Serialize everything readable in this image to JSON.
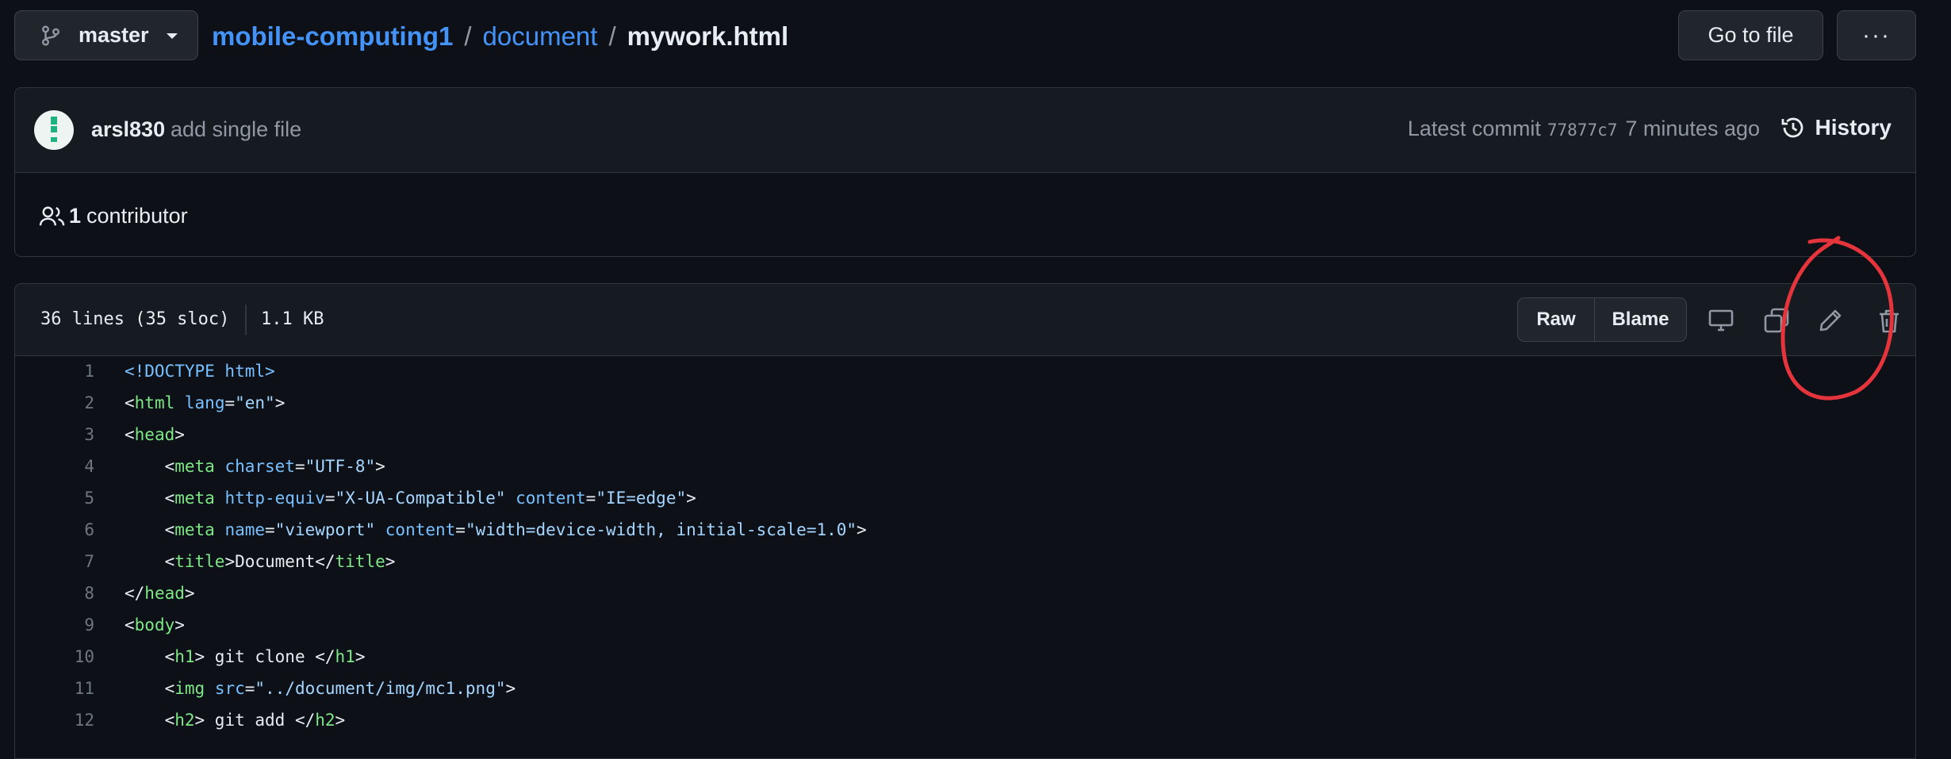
{
  "branch": {
    "name": "master"
  },
  "breadcrumb": {
    "repo": "mobile-computing1",
    "sep1": "/",
    "folder": "document",
    "sep2": "/",
    "file": "mywork.html"
  },
  "actions": {
    "go_to_file": "Go to file",
    "more": "···"
  },
  "commit": {
    "author": "arsl830",
    "message": "add single file",
    "latest_label": "Latest commit",
    "sha": "77877c7",
    "time": "7 minutes ago",
    "history": "History"
  },
  "contributors": {
    "count": "1",
    "label": "contributor"
  },
  "file_info": {
    "lines": "36 lines (35 sloc)",
    "size": "1.1 KB"
  },
  "file_actions": {
    "raw": "Raw",
    "blame": "Blame"
  },
  "code_lines": [
    {
      "n": "1",
      "tokens": [
        {
          "t": "<!DOCTYPE html>",
          "c": "at"
        }
      ]
    },
    {
      "n": "2",
      "tokens": [
        {
          "t": "<",
          "c": "p"
        },
        {
          "t": "html",
          "c": "tg"
        },
        {
          "t": " ",
          "c": "p"
        },
        {
          "t": "lang",
          "c": "at"
        },
        {
          "t": "=\"en\"",
          "c": "p"
        },
        {
          "t": ">",
          "c": "p"
        }
      ]
    },
    {
      "n": "3",
      "tokens": [
        {
          "t": "<",
          "c": "p"
        },
        {
          "t": "head",
          "c": "tg"
        },
        {
          "t": ">",
          "c": "p"
        }
      ]
    },
    {
      "n": "4",
      "tokens": [
        {
          "t": "    <",
          "c": "p"
        },
        {
          "t": "meta",
          "c": "tg"
        },
        {
          "t": " ",
          "c": "p"
        },
        {
          "t": "charset",
          "c": "at"
        },
        {
          "t": "=\"UTF-8\">",
          "c": "p"
        }
      ]
    },
    {
      "n": "5",
      "tokens": [
        {
          "t": "    <",
          "c": "p"
        },
        {
          "t": "meta",
          "c": "tg"
        },
        {
          "t": " ",
          "c": "p"
        },
        {
          "t": "http-equiv",
          "c": "at"
        },
        {
          "t": "=\"X-UA-Compatible\" ",
          "c": "p"
        },
        {
          "t": "content",
          "c": "at"
        },
        {
          "t": "=\"IE=edge\">",
          "c": "p"
        }
      ]
    },
    {
      "n": "6",
      "tokens": [
        {
          "t": "    <",
          "c": "p"
        },
        {
          "t": "meta",
          "c": "tg"
        },
        {
          "t": " ",
          "c": "p"
        },
        {
          "t": "name",
          "c": "at"
        },
        {
          "t": "=\"viewport\" ",
          "c": "p"
        },
        {
          "t": "content",
          "c": "at"
        },
        {
          "t": "=\"width=device-width, initial-scale=1.0\">",
          "c": "p"
        }
      ]
    },
    {
      "n": "7",
      "tokens": [
        {
          "t": "    <",
          "c": "p"
        },
        {
          "t": "title",
          "c": "tg"
        },
        {
          "t": ">Document</",
          "c": "p"
        },
        {
          "t": "title",
          "c": "tg"
        },
        {
          "t": ">",
          "c": "p"
        }
      ]
    },
    {
      "n": "8",
      "tokens": [
        {
          "t": "</",
          "c": "p"
        },
        {
          "t": "head",
          "c": "tg"
        },
        {
          "t": ">",
          "c": "p"
        }
      ]
    },
    {
      "n": "9",
      "tokens": [
        {
          "t": "<",
          "c": "p"
        },
        {
          "t": "body",
          "c": "tg"
        },
        {
          "t": ">",
          "c": "p"
        }
      ]
    },
    {
      "n": "10",
      "tokens": [
        {
          "t": "    <",
          "c": "p"
        },
        {
          "t": "h1",
          "c": "tg"
        },
        {
          "t": "> git clone </",
          "c": "p"
        },
        {
          "t": "h1",
          "c": "tg"
        },
        {
          "t": ">",
          "c": "p"
        }
      ]
    },
    {
      "n": "11",
      "tokens": [
        {
          "t": "    <",
          "c": "p"
        },
        {
          "t": "img",
          "c": "tg"
        },
        {
          "t": " ",
          "c": "p"
        },
        {
          "t": "src",
          "c": "at"
        },
        {
          "t": "=\"../document/img/mc1.png\">",
          "c": "p"
        }
      ]
    },
    {
      "n": "12",
      "tokens": [
        {
          "t": "    <",
          "c": "p"
        },
        {
          "t": "h2",
          "c": "tg"
        },
        {
          "t": "> git add </",
          "c": "p"
        },
        {
          "t": "h2",
          "c": "tg"
        },
        {
          "t": ">",
          "c": "p"
        }
      ]
    }
  ],
  "colors": {
    "background": "#0d1117",
    "link": "#4493f8",
    "annotation": "#e5343b"
  },
  "icons": [
    "branch-icon",
    "caret-down-icon",
    "people-icon",
    "history-icon",
    "desktop-icon",
    "copy-icon",
    "pencil-icon",
    "trash-icon"
  ]
}
